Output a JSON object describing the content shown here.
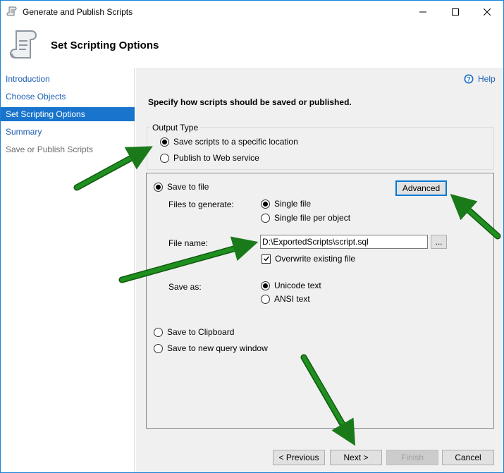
{
  "window": {
    "title": "Generate and Publish Scripts",
    "controls": [
      "minimize-icon",
      "maximize-icon",
      "close-icon"
    ]
  },
  "header": {
    "title": "Set Scripting Options",
    "icon": "script-scroll-icon"
  },
  "nav": {
    "items": [
      {
        "label": "Introduction",
        "state": "link"
      },
      {
        "label": "Choose Objects",
        "state": "link"
      },
      {
        "label": "Set Scripting Options",
        "state": "selected"
      },
      {
        "label": "Summary",
        "state": "link"
      },
      {
        "label": "Save or Publish Scripts",
        "state": "disabled"
      }
    ]
  },
  "help": {
    "label": "Help",
    "icon": "help-icon"
  },
  "instruction": "Specify how scripts should be saved or published.",
  "output_type": {
    "legend": "Output Type",
    "options": [
      {
        "label": "Save scripts to a specific location",
        "selected": true
      },
      {
        "label": "Publish to Web service",
        "selected": false
      }
    ]
  },
  "save": {
    "save_to_file": "Save to file",
    "advanced": "Advanced",
    "files_to_generate_label": "Files to generate:",
    "single_file": "Single file",
    "single_file_per_object": "Single file per object",
    "file_name_label": "File name:",
    "file_name_value": "D:\\ExportedScripts\\script.sql",
    "browse": "...",
    "overwrite": "Overwrite existing file",
    "overwrite_checked": true,
    "save_as_label": "Save as:",
    "unicode_text": "Unicode text",
    "ansi_text": "ANSI text",
    "save_to_clipboard": "Save to Clipboard",
    "save_to_new_query_window": "Save to new query window"
  },
  "footer": {
    "previous": "< Previous",
    "next": "Next >",
    "finish": "Finish",
    "cancel": "Cancel"
  },
  "colors": {
    "accent": "#1874cd",
    "annotation_arrow": "#1a7a1a"
  }
}
